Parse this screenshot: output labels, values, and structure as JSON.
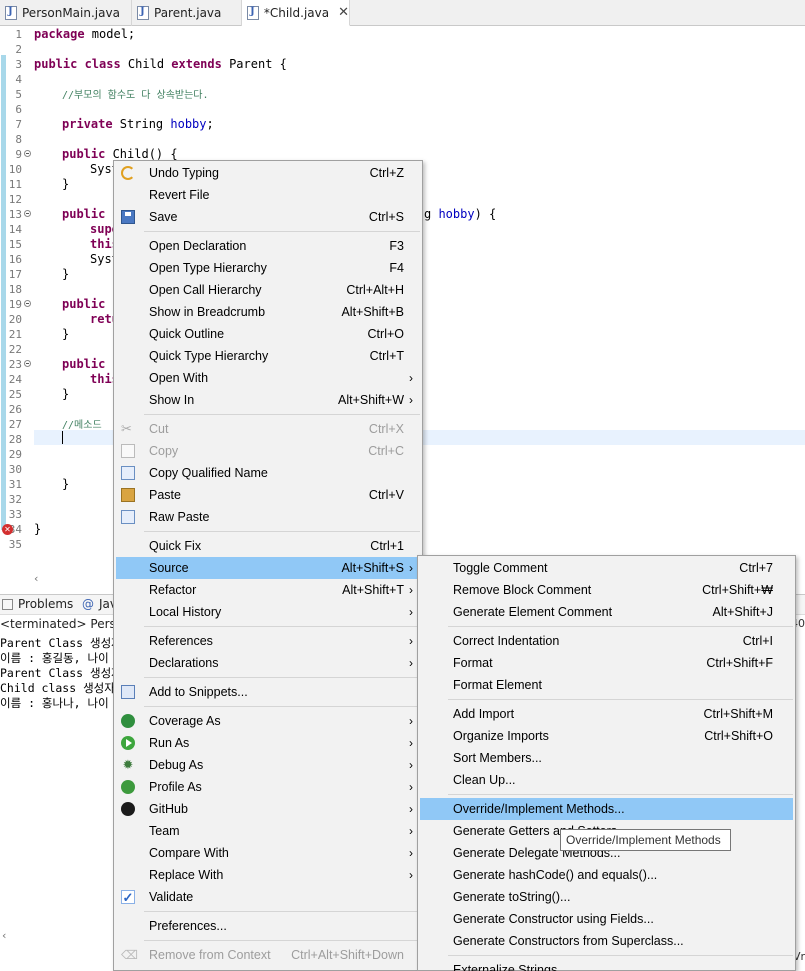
{
  "tabs": [
    {
      "label": "PersonMain.java",
      "active": false
    },
    {
      "label": "Parent.java",
      "active": false
    },
    {
      "label": "*Child.java",
      "active": true
    }
  ],
  "editor": {
    "line_numbers": [
      "1",
      "2",
      "3",
      "4",
      "5",
      "6",
      "7",
      "8",
      "9",
      "10",
      "11",
      "12",
      "13",
      "14",
      "15",
      "16",
      "17",
      "18",
      "19",
      "20",
      "21",
      "22",
      "23",
      "24",
      "25",
      "26",
      "27",
      "28",
      "29",
      "30",
      "31",
      "32",
      "33",
      "34",
      "35"
    ],
    "lines": {
      "l1_kw": "package",
      "l1_rest": " model;",
      "l3_kw": "public class",
      "l3_mid": " Child ",
      "l3_kw2": "extends",
      "l3_rest": " Parent {",
      "l5_cmt": "//부모의 함수도 다 상속받는다.",
      "l7_kw": "private",
      "l7_mid": " String ",
      "l7_fld": "hobby",
      "l7_rest": ";",
      "l9_kw": "public",
      "l9_rest": " Child() {",
      "l10": "Syst",
      "l11": "}",
      "l13_kw": "public",
      "l13_rest": " C",
      "l13_tail_pre": "g ",
      "l13_tail_param": "hobby",
      "l13_tail_post": ") {",
      "l14_kw": "supe",
      "l15_kw": "this",
      "l16": "Syst",
      "l17": "}",
      "l19_kw": "public",
      "l19_rest": " S",
      "l20_kw": "retu",
      "l21": "}",
      "l23_kw": "public",
      "l23_rest": " v",
      "l24_kw": "this",
      "l25": "}",
      "l27_cmt": "//메소드",
      "l31": "}",
      "l34": "}"
    }
  },
  "panel": {
    "tabs": [
      {
        "label": "Problems"
      },
      {
        "label": "Jav"
      }
    ],
    "status": "<terminated> PersonM",
    "right_edge": "40",
    "right_edge_bottom": "Vr",
    "console": [
      "Parent Class 생성자",
      "이름 : 홍길동, 나이 :",
      "Parent Class 생성자",
      "Child class 생성자",
      "이름 : 홍나나, 나이 :"
    ]
  },
  "context_menu": {
    "items": [
      {
        "label": "Undo Typing",
        "shortcut": "Ctrl+Z",
        "icon": "undo-icon"
      },
      {
        "label": "Revert File"
      },
      {
        "label": "Save",
        "shortcut": "Ctrl+S",
        "icon": "save-icon"
      },
      {
        "label": "Open Declaration",
        "shortcut": "F3"
      },
      {
        "label": "Open Type Hierarchy",
        "shortcut": "F4"
      },
      {
        "label": "Open Call Hierarchy",
        "shortcut": "Ctrl+Alt+H"
      },
      {
        "label": "Show in Breadcrumb",
        "shortcut": "Alt+Shift+B"
      },
      {
        "label": "Quick Outline",
        "shortcut": "Ctrl+O"
      },
      {
        "label": "Quick Type Hierarchy",
        "shortcut": "Ctrl+T"
      },
      {
        "label": "Open With",
        "submenu": true
      },
      {
        "label": "Show In",
        "shortcut": "Alt+Shift+W",
        "submenu": true
      },
      {
        "label": "Cut",
        "shortcut": "Ctrl+X",
        "disabled": true,
        "icon": "scissors-icon"
      },
      {
        "label": "Copy",
        "shortcut": "Ctrl+C",
        "disabled": true,
        "icon": "copy-icon"
      },
      {
        "label": "Copy Qualified Name",
        "icon": "copy-qualified-name-icon"
      },
      {
        "label": "Paste",
        "shortcut": "Ctrl+V",
        "icon": "paste-icon"
      },
      {
        "label": "Raw Paste",
        "icon": "raw-paste-icon"
      },
      {
        "label": "Quick Fix",
        "shortcut": "Ctrl+1"
      },
      {
        "label": "Source",
        "shortcut": "Alt+Shift+S",
        "submenu": true,
        "selected": true
      },
      {
        "label": "Refactor",
        "shortcut": "Alt+Shift+T",
        "submenu": true
      },
      {
        "label": "Local History",
        "submenu": true
      },
      {
        "label": "References",
        "submenu": true
      },
      {
        "label": "Declarations",
        "submenu": true
      },
      {
        "label": "Add to Snippets...",
        "icon": "snippets-icon"
      },
      {
        "label": "Coverage As",
        "submenu": true,
        "icon": "coverage-icon"
      },
      {
        "label": "Run As",
        "submenu": true,
        "icon": "run-icon"
      },
      {
        "label": "Debug As",
        "submenu": true,
        "icon": "debug-bug-icon"
      },
      {
        "label": "Profile As",
        "submenu": true,
        "icon": "profile-icon"
      },
      {
        "label": "GitHub",
        "submenu": true,
        "icon": "github-icon"
      },
      {
        "label": "Team",
        "submenu": true
      },
      {
        "label": "Compare With",
        "submenu": true
      },
      {
        "label": "Replace With",
        "submenu": true
      },
      {
        "label": "Validate",
        "icon": "checkbox-checked-icon"
      },
      {
        "label": "Preferences..."
      },
      {
        "label": "Remove from Context",
        "shortcut": "Ctrl+Alt+Shift+Down",
        "disabled": true,
        "icon": "remove-context-icon"
      }
    ]
  },
  "source_submenu": {
    "items": [
      {
        "label": "Toggle Comment",
        "shortcut": "Ctrl+7"
      },
      {
        "label": "Remove Block Comment",
        "shortcut": "Ctrl+Shift+₩"
      },
      {
        "label": "Generate Element Comment",
        "shortcut": "Alt+Shift+J"
      },
      {
        "label": "Correct Indentation",
        "shortcut": "Ctrl+I"
      },
      {
        "label": "Format",
        "shortcut": "Ctrl+Shift+F"
      },
      {
        "label": "Format Element"
      },
      {
        "label": "Add Import",
        "shortcut": "Ctrl+Shift+M"
      },
      {
        "label": "Organize Imports",
        "shortcut": "Ctrl+Shift+O"
      },
      {
        "label": "Sort Members..."
      },
      {
        "label": "Clean Up..."
      },
      {
        "label": "Override/Implement Methods...",
        "selected": true
      },
      {
        "label": "Generate Getters and Setters..."
      },
      {
        "label": "Generate Delegate Methods..."
      },
      {
        "label": "Generate hashCode() and equals()..."
      },
      {
        "label": "Generate toString()..."
      },
      {
        "label": "Generate Constructor using Fields..."
      },
      {
        "label": "Generate Constructors from Superclass..."
      },
      {
        "label": "Externalize Strings..."
      }
    ]
  },
  "tooltip": "Override/Implement Methods"
}
